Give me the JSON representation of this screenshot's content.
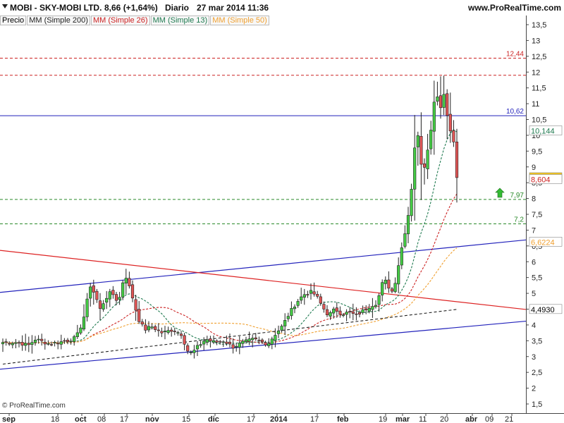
{
  "header": {
    "symbol": "MOBI - SKY-MOBI LTD.",
    "change": "8,66 (+1,64%)",
    "period": "Diario",
    "datetime": "27 mar 2014 11:36",
    "site": "www.ProRealTime.com"
  },
  "legend": {
    "price": "Precio",
    "ma200": "MM (Simple 200)",
    "ma26": "MM (Simple 26)",
    "ma13": "MM (Simple 13)",
    "ma50": "MM (Simple 50)"
  },
  "footer": {
    "copyright": "© ProRealTime.com"
  },
  "colors": {
    "ma200": "#222222",
    "ma26": "#cc2222",
    "ma13": "#1f7a50",
    "ma50": "#f0a030",
    "up": "#44cc44",
    "down": "#e05555",
    "trend_blue": "#2222bb",
    "trend_red": "#dd2222"
  },
  "chart_data": {
    "type": "candlestick",
    "yrange": [
      1.25,
      13.75
    ],
    "y_tick_labels": [
      "1,5",
      "2",
      "2,5",
      "3",
      "3,5",
      "4",
      "4,5",
      "5",
      "5,5",
      "6",
      "6,5",
      "7",
      "7,5",
      "8",
      "8,5",
      "9",
      "9,5",
      "10",
      "10,5",
      "11",
      "11,5",
      "12",
      "12,5",
      "13",
      "13,5"
    ],
    "x_tick_labels": [
      "sep",
      "18",
      "oct",
      "08",
      "17",
      "nov",
      "15",
      "dic",
      "17",
      "2014",
      "17",
      "feb",
      "19",
      "mar",
      "11",
      "20",
      "abr",
      "09",
      "21"
    ],
    "last_close": "8,66",
    "last_change": "+1,64%",
    "hlines": [
      {
        "value": 12.44,
        "label": "12,44",
        "color": "#cc2222",
        "style": "dashed"
      },
      {
        "value": 11.9,
        "label": "",
        "color": "#cc2222",
        "style": "dashed"
      },
      {
        "value": 10.62,
        "label": "10,62",
        "color": "#2222bb",
        "style": "solid"
      },
      {
        "value": 7.97,
        "label": "7,97",
        "color": "#2a8a2a",
        "style": "dashed"
      },
      {
        "value": 7.2,
        "label": "7,2",
        "color": "#2a8a2a",
        "style": "dashed"
      }
    ],
    "axis_value_tags": [
      {
        "value": 10.144,
        "label": "10,144",
        "color": "#1f7a50",
        "bg": "#ffffff"
      },
      {
        "value": 8.66,
        "label": "8,66",
        "color": "#000000",
        "bg": "#f5c518"
      },
      {
        "value": 8.604,
        "label": "8,604",
        "color": "#cc2222",
        "bg": "#ffffff"
      },
      {
        "value": 6.6224,
        "label": "6,6224",
        "color": "#f0a030",
        "bg": "#ffffff"
      },
      {
        "value": 4.493,
        "label": "4,4930",
        "color": "#000000",
        "bg": "#ffffff"
      }
    ],
    "key_points": [
      {
        "date": "sep",
        "close": 3.45
      },
      {
        "date": "oct",
        "close": 4.2
      },
      {
        "date": "17 oct",
        "close": 5.5
      },
      {
        "date": "nov",
        "close": 4.0
      },
      {
        "date": "15 nov",
        "close": 3.1
      },
      {
        "date": "dic",
        "close": 3.5
      },
      {
        "date": "2014",
        "close": 3.4
      },
      {
        "date": "17 ene",
        "close": 5.0
      },
      {
        "date": "feb",
        "close": 4.2
      },
      {
        "date": "19 feb",
        "close": 5.2
      },
      {
        "date": "mar",
        "close": 8.0
      },
      {
        "date": "11 mar",
        "close": 10.6
      },
      {
        "date": "20 mar",
        "close": 11.4
      },
      {
        "date": "27 mar",
        "close": 8.66
      }
    ]
  }
}
